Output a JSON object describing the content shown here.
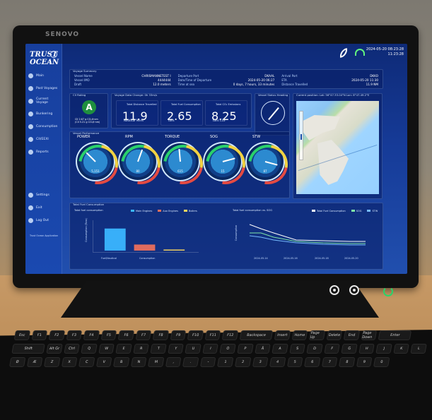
{
  "device": {
    "brand": "SENOVO"
  },
  "app": {
    "logo": "TRUST OCEAN",
    "timestamp_date": "2024-05-20 08:23:28",
    "timestamp_time": "11:23:28",
    "nav": [
      {
        "label": "Main",
        "icon": "home-icon"
      },
      {
        "label": "Past Voyages",
        "icon": "history-icon"
      },
      {
        "label": "Current Voyage",
        "icon": "ship-icon"
      },
      {
        "label": "Bunkering",
        "icon": "fuel-icon"
      },
      {
        "label": "Consumption",
        "icon": "chart-icon"
      },
      {
        "label": "CII/EEXI",
        "icon": "leaf-icon"
      },
      {
        "label": "Reports",
        "icon": "report-icon"
      }
    ],
    "bottom_nav": [
      {
        "label": "Settings",
        "icon": "gear-icon"
      },
      {
        "label": "Exit",
        "icon": "exit-icon"
      },
      {
        "label": "Log Out",
        "icon": "logout-icon"
      }
    ],
    "footer_note": "Trust Ocean Application"
  },
  "voyage_summary": {
    "title": "Voyage Summary",
    "left": [
      {
        "label": "Vessel Name",
        "value": "CHRISMANNETEST I"
      },
      {
        "label": "Vessel IMO",
        "value": "4444444"
      },
      {
        "label": "Draft",
        "value": "12.0 meters"
      }
    ],
    "middle": [
      {
        "label": "Departure Port",
        "value": "DKAAL"
      },
      {
        "label": "Date/Time of Departure",
        "value": "2024-05-20 06:27"
      },
      {
        "label": "Time at sea",
        "value": "0 days, 7 hours, 33 minutes"
      }
    ],
    "right": [
      {
        "label": "Arrival Port",
        "value": "DKKO"
      },
      {
        "label": "ETA",
        "value": "2024-05-20 11:30"
      },
      {
        "label": "Distance Travelled",
        "value": "11.9 NM"
      }
    ]
  },
  "cii_rating": {
    "title": "CII Rating",
    "grade": "A",
    "line1": "CII 2.67 g CO₂/t·nm",
    "line2": "(CII 5.21 g CO₂/t·nm)"
  },
  "voyage_metrics": {
    "title": "Voyage Data Change: 0h 33m/s",
    "items": [
      {
        "icon": "route-icon",
        "title": "Total Distance Travelled",
        "value": "11.9",
        "unit": "Nautical Miles"
      },
      {
        "icon": "fuel-icon",
        "title": "Total Fuel Consumption",
        "value": "2.65",
        "unit": "tons"
      },
      {
        "icon": "co2-icon",
        "title": "Total CO₂ Emissions",
        "value": "8.25",
        "unit": "tons CO₂"
      }
    ]
  },
  "heading": {
    "title": "Vessel Status Heading"
  },
  "map": {
    "title": "Current position: Lat: 56°47.33.04°N Lon: 8°47.49.2°E"
  },
  "gauges": {
    "title": "Vessel Performance",
    "items": [
      {
        "label": "POWER",
        "value": "5,151",
        "angle": -45
      },
      {
        "label": "RPM",
        "value": "80",
        "angle": 20
      },
      {
        "label": "TORQUE",
        "value": "615",
        "angle": -5
      },
      {
        "label": "SOG",
        "value": "15",
        "angle": 75
      },
      {
        "label": "STW",
        "value": "87",
        "angle": 105
      }
    ]
  },
  "consumption": {
    "title": "Total Fuel Consumption",
    "left_chart_title": "Total fuel consumption",
    "right_chart_title": "Total fuel consumption vs. SOG",
    "legend": [
      "Main Engines",
      "Aux Engines",
      "Boilers"
    ],
    "legend_right": [
      "Total Fuel Consumption",
      "SOG",
      "STW"
    ],
    "y_label_left": "Consumption (Tons)",
    "y_label_right": "Consumption",
    "x_labels_left": [
      "Fuel/Nautical",
      "Consumption"
    ],
    "x_labels_right": [
      "2024-05-14",
      "2024-05-16",
      "2024-05-18",
      "2024-05-20"
    ]
  },
  "chart_data": {
    "type": "bar",
    "categories": [
      "Main Engines",
      "Aux Engines",
      "Boilers"
    ],
    "values": [
      2.0,
      0.55,
      0.1
    ],
    "title": "",
    "xlabel": "",
    "ylabel": "",
    "ylim": [
      0,
      2.5
    ]
  },
  "keyboard": {
    "keys": [
      "Esc",
      "F1",
      "F2",
      "F3",
      "F4",
      "F5",
      "F6",
      "F7",
      "F8",
      "F9",
      "F10",
      "F11",
      "F12",
      "Backspace",
      "Insert",
      "Home",
      "Page Up",
      "Delete",
      "End",
      "Page Down",
      "Enter",
      "Shift",
      "Alt Gr",
      "Ctrl",
      "Q",
      "W",
      "E",
      "R",
      "T",
      "Y",
      "U",
      "I",
      "O",
      "P",
      "Å",
      "A",
      "S",
      "D",
      "F",
      "G",
      "H",
      "J",
      "K",
      "L",
      "Ø",
      "Æ",
      "Z",
      "X",
      "C",
      "V",
      "B",
      "N",
      "M",
      ",",
      ".",
      "-",
      "1",
      "2",
      "3",
      "4",
      "5",
      "6",
      "7",
      "8",
      "9",
      "0"
    ]
  },
  "colors": {
    "screen_bg": "#1a4aa8",
    "panel_bg": "#0c2a7a",
    "accent_green": "#27d56a",
    "grade_green": "#1f8f3f"
  }
}
